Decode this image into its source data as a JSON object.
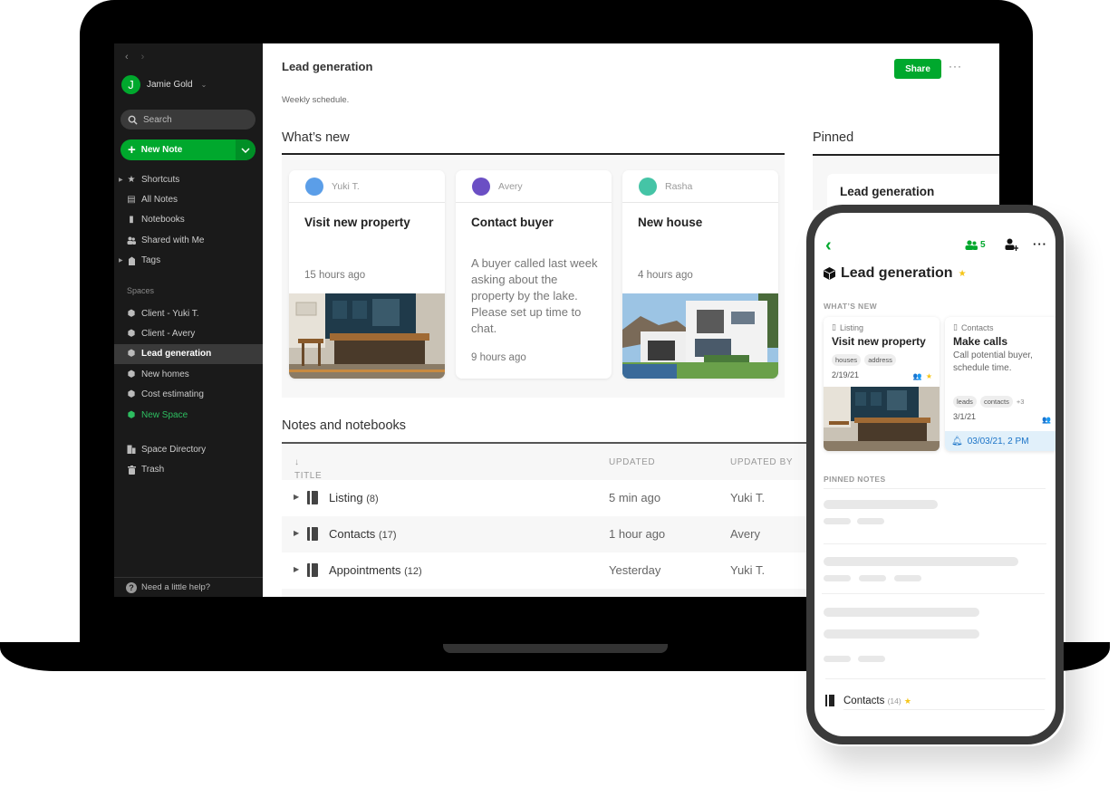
{
  "sidebar": {
    "back_icon": "‹",
    "forward_icon": "›",
    "user": {
      "initial": "J",
      "name": "Jamie Gold",
      "caret": "⌄"
    },
    "search": {
      "placeholder": "Search"
    },
    "new_note": {
      "label": "New Note",
      "plus": "+",
      "dropdown": "⌄"
    },
    "nav_items": [
      {
        "label": "Shortcuts",
        "icon": "star-icon",
        "glyph": "★",
        "expandable": true
      },
      {
        "label": "All Notes",
        "icon": "note-icon",
        "glyph": "▤",
        "expandable": false
      },
      {
        "label": "Notebooks",
        "icon": "notebook-icon",
        "glyph": "▮",
        "expandable": false
      },
      {
        "label": "Shared with Me",
        "icon": "shared-icon",
        "glyph": "👥",
        "expandable": false
      },
      {
        "label": "Tags",
        "icon": "tag-icon",
        "glyph": "◆",
        "expandable": true
      }
    ],
    "spaces_label": "Spaces",
    "spaces": [
      {
        "label": "Client - Yuki T.",
        "active": false
      },
      {
        "label": "Client - Avery",
        "active": false
      },
      {
        "label": "Lead generation",
        "active": true
      },
      {
        "label": "New homes",
        "active": false
      },
      {
        "label": "Cost estimating",
        "active": false
      }
    ],
    "new_space": "New Space",
    "space_directory": "Space Directory",
    "trash": "Trash",
    "help": "Need a little help?",
    "help_glyph": "?"
  },
  "main": {
    "title": "Lead generation",
    "share_label": "Share",
    "more_glyph": "···",
    "subtitle": "Weekly schedule.",
    "whats_new_heading": "What’s new",
    "pinned_heading": "Pinned",
    "pinned_card_title": "Lead generation",
    "cards": [
      {
        "author": "Yuki T.",
        "avatar_color": "#5b9ee8",
        "title": "Visit new property",
        "body": "",
        "time": "15 hours ago",
        "image": "kitchen"
      },
      {
        "author": "Avery",
        "avatar_color": "#6b4fc4",
        "title": "Contact buyer",
        "body": "A buyer called last week asking about the property by the lake. Please set up time to chat.",
        "time": "9 hours ago",
        "image": ""
      },
      {
        "author": "Rasha",
        "avatar_color": "#45c4a6",
        "title": "New house",
        "body": "",
        "time": "4 hours ago",
        "image": "house"
      }
    ],
    "notes_heading": "Notes and notebooks",
    "table": {
      "columns": [
        "TITLE",
        "UPDATED",
        "UPDATED BY"
      ],
      "sort_glyph": "↓",
      "rows": [
        {
          "title": "Listing",
          "count": "(8)",
          "updated": "5 min ago",
          "updated_by": "Yuki T."
        },
        {
          "title": "Contacts",
          "count": "(17)",
          "updated": "1 hour ago",
          "updated_by": "Avery"
        },
        {
          "title": "Appointments",
          "count": "(12)",
          "updated": "Yesterday",
          "updated_by": "Yuki T."
        }
      ]
    }
  },
  "phone": {
    "back_glyph": "‹",
    "shared_count": "5",
    "more_glyph": "···",
    "title": "Lead generation",
    "star": "★",
    "whats_new_label": "WHAT’S NEW",
    "cards": [
      {
        "notebook": "Listing",
        "title": "Visit new property",
        "tags": [
          "houses",
          "address"
        ],
        "date": "2/19/21",
        "image": "kitchen"
      },
      {
        "notebook": "Contacts",
        "title": "Make calls",
        "description": "Call potential buyer, schedule time.",
        "tags": [
          "leads",
          "contacts"
        ],
        "extra_tags": "+3",
        "date": "3/1/21",
        "reminder": "03/03/21, 2 PM"
      }
    ],
    "pinned_notes_label": "PINNED NOTES",
    "contacts_item": {
      "label": "Contacts",
      "count": "(14)"
    }
  },
  "colors": {
    "accent": "#00a82d",
    "sidebar_bg": "#1a1a1a",
    "reminder_bg": "#e1f0fa",
    "reminder_text": "#1a73c7",
    "star": "#f5c518"
  }
}
